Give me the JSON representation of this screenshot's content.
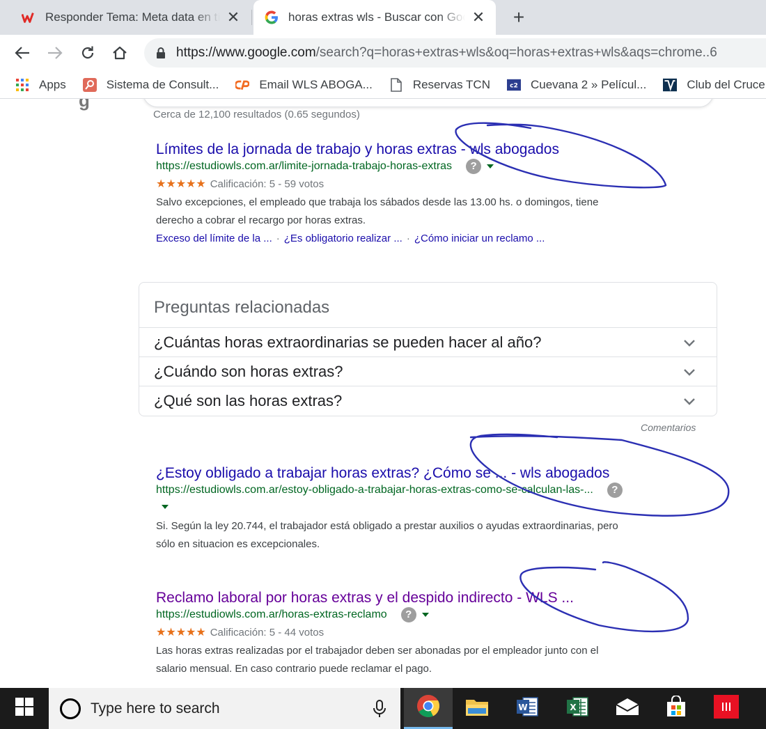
{
  "browser": {
    "tabs": [
      {
        "title": "Responder Tema: Meta data en tí",
        "favicon": "wattpad-w-icon",
        "active": false
      },
      {
        "title": "horas extras wls - Buscar con Goo",
        "favicon": "google-g-icon",
        "active": true
      }
    ],
    "new_tab_label": "+",
    "close_label": "✕",
    "url_main": "https://www.google.com",
    "url_rest": "/search?q=horas+extras+wls&oq=horas+extras+wls&aqs=chrome..6",
    "bookmarks": [
      {
        "label": "Apps",
        "icon": "apps-grid-icon"
      },
      {
        "label": "Sistema de Consult...",
        "icon": "search-doc-icon"
      },
      {
        "label": "Email WLS ABOGA...",
        "icon": "cpanel-icon"
      },
      {
        "label": "Reservas TCN",
        "icon": "page-icon"
      },
      {
        "label": "Cuevana 2 » Películ...",
        "icon": "cuevana-icon"
      },
      {
        "label": "Club del Cruce",
        "icon": "club-icon"
      }
    ]
  },
  "search": {
    "stats": "Cerca de 12,100 resultados (0.65 segundos)",
    "results": [
      {
        "title": "Límites de la jornada de trabajo y horas extras - wls abogados",
        "url": "https://estudiowls.com.ar/limite-jornada-trabajo-horas-extras",
        "stars": "★★★★★",
        "rating": "Calificación: 5 - 59 votos",
        "snippet_lines": [
          "Salvo excepciones, el empleado que trabaja los sábados desde las 13.00 hs. o domingos, tiene",
          "derecho a cobrar el recargo por horas extras."
        ],
        "sitelinks": [
          "Exceso del límite de la ...",
          "¿Es obligatorio realizar ...",
          "¿Cómo iniciar un reclamo ..."
        ]
      },
      {
        "title": "¿Estoy obligado a trabajar horas extras? ¿Cómo se ... - wls abogados",
        "url": "https://estudiowls.com.ar/estoy-obligado-a-trabajar-horas-extras-como-se-calculan-las-...",
        "snippet_lines": [
          "Si. Según la ley 20.744, el trabajador está obligado a prestar auxilios o ayudas extraordinarias, pero",
          "sólo en situacion es excepcionales."
        ]
      },
      {
        "title": "Reclamo laboral por horas extras y el despido indirecto - WLS ...",
        "url": "https://estudiowls.com.ar/horas-extras-reclamo",
        "stars": "★★★★★",
        "rating": "Calificación: 5 - 44 votos",
        "snippet_lines": [
          "Las horas extras realizadas por el trabajador deben ser abonadas por el empleador junto con el",
          "salario mensual. En caso contrario puede reclamar el pago."
        ]
      }
    ],
    "related": {
      "heading": "Preguntas relacionadas",
      "questions": [
        "¿Cuántas horas extraordinarias se pueden hacer al año?",
        "¿Cuándo son horas extras?",
        "¿Qué son las horas extras?"
      ],
      "feedback": "Comentarios"
    },
    "badge_label": "?"
  },
  "taskbar": {
    "search_placeholder": "Type here to search",
    "apps": [
      "chrome-icon",
      "file-explorer-icon",
      "word-icon",
      "excel-icon",
      "mail-icon",
      "store-icon",
      "red-app-icon"
    ]
  },
  "colors": {
    "link": "#1a0dab",
    "visited": "#660099",
    "url_green": "#006621",
    "annotation_pen": "#2b2fb3"
  }
}
